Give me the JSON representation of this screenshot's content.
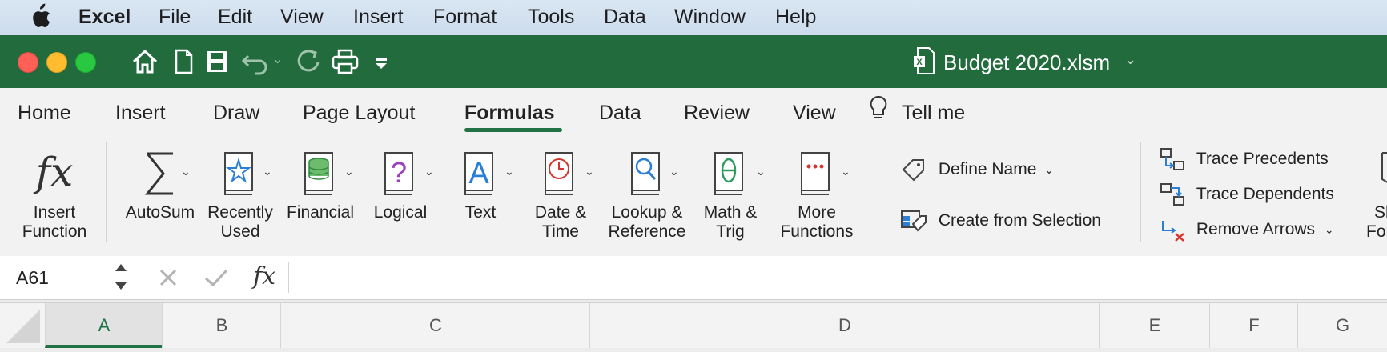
{
  "menubar": {
    "app_name": "Excel",
    "items": [
      "File",
      "Edit",
      "View",
      "Insert",
      "Format",
      "Tools",
      "Data",
      "Window",
      "Help"
    ]
  },
  "titlebar": {
    "title": "Budget 2020.xlsm"
  },
  "tabs": [
    "Home",
    "Insert",
    "Draw",
    "Page Layout",
    "Formulas",
    "Data",
    "Review",
    "View"
  ],
  "active_tab": "Formulas",
  "tell_me": "Tell me",
  "ribbon": {
    "insert_function": {
      "line1": "Insert",
      "line2": "Function"
    },
    "functions": [
      {
        "line1": "AutoSum",
        "line2": ""
      },
      {
        "line1": "Recently",
        "line2": "Used"
      },
      {
        "line1": "Financial",
        "line2": ""
      },
      {
        "line1": "Logical",
        "line2": ""
      },
      {
        "line1": "Text",
        "line2": ""
      },
      {
        "line1": "Date &",
        "line2": "Time"
      },
      {
        "line1": "Lookup &",
        "line2": "Reference"
      },
      {
        "line1": "Math &",
        "line2": "Trig"
      },
      {
        "line1": "More",
        "line2": "Functions"
      }
    ],
    "define_name": "Define Name",
    "create_from_selection": "Create from Selection",
    "trace_precedents": "Trace Precedents",
    "trace_dependents": "Trace Dependents",
    "remove_arrows": "Remove Arrows",
    "show_formulas_partial": {
      "line1": "Sh",
      "line2": "Form"
    }
  },
  "formula_bar": {
    "name_box": "A61",
    "fx_symbol": "fx"
  },
  "columns": [
    "A",
    "B",
    "C",
    "D",
    "E",
    "F",
    "G"
  ],
  "selected_column": "A",
  "colors": {
    "excel_green": "#217346",
    "titlebar_green": "#226b3d"
  }
}
